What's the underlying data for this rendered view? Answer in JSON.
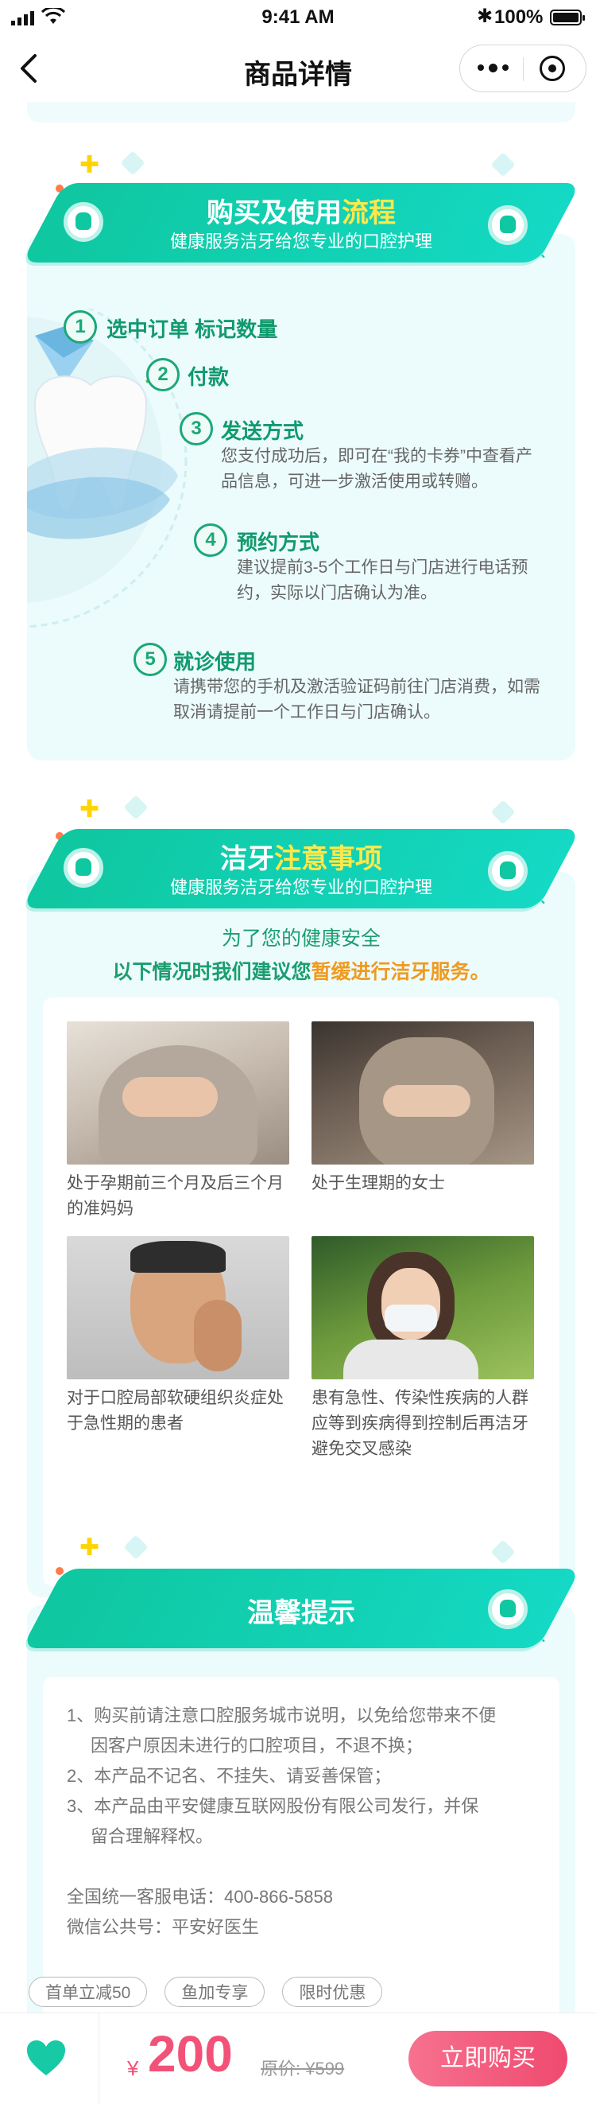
{
  "status_bar": {
    "time": "9:41 AM",
    "battery": "100%"
  },
  "nav": {
    "title": "商品详情"
  },
  "section1": {
    "title_main": "购买及使用",
    "title_highlight": "流程",
    "subtitle": "健康服务洁牙给您专业的口腔护理",
    "steps": [
      {
        "num": "1",
        "title": "选中订单 标记数量",
        "desc": ""
      },
      {
        "num": "2",
        "title": "付款",
        "desc": ""
      },
      {
        "num": "3",
        "title": "发送方式",
        "desc": "您支付成功后，即可在“我的卡券”中查看产品信息，可进一步激活使用或转赠。"
      },
      {
        "num": "4",
        "title": "预约方式",
        "desc": "建议提前3-5个工作日与门店进行电话预约，实际以门店确认为准。"
      },
      {
        "num": "5",
        "title": "就诊使用",
        "desc": "请携带您的手机及激活验证码前往门店消费，如需取消请提前一个工作日与门店确认。"
      }
    ]
  },
  "section2": {
    "title_main": "洁牙",
    "title_highlight": "注意事项",
    "subtitle": "健康服务洁牙给您专业的口腔护理",
    "intro_line1": "为了您的健康安全",
    "intro_line2_prefix": "以下情况时我们建议您",
    "intro_line2_highlight": "暂缓进行洁牙服务。",
    "cases": [
      {
        "caption": "处于孕期前三个月及后三个月的准妈妈"
      },
      {
        "caption": "处于生理期的女士"
      },
      {
        "caption": "对于口腔局部软硬组织炎症处于急性期的患者"
      },
      {
        "caption": "患有急性、传染性疾病的人群应等到疾病得到控制后再洁牙避免交叉感染"
      }
    ]
  },
  "section3": {
    "title": "温馨提示",
    "tips": [
      {
        "line1": "1、购买前请注意口腔服务城市说明，以免给您带来不便",
        "line2": "因客户原因未进行的口腔项目，不退不换；"
      },
      {
        "line1": "2、本产品不记名、不挂失、请妥善保管；",
        "line2": ""
      },
      {
        "line1": "3、本产品由平安健康互联网股份有限公司发行，并保",
        "line2": "留合理解释权。"
      }
    ],
    "hotline": "全国统一客服电话：400-866-5858",
    "wechat": "微信公共号：平安好医生"
  },
  "tags": [
    "首单立减50",
    "鱼加专享",
    "限时优惠"
  ],
  "bottom": {
    "currency": "¥",
    "price": "200",
    "original_price": "原价: ¥599",
    "buy_label": "立即购买"
  },
  "colors": {
    "accent": "#0fc7a0",
    "price": "#f25277",
    "highlight": "#ffe94a",
    "warning": "#f09a1f"
  }
}
